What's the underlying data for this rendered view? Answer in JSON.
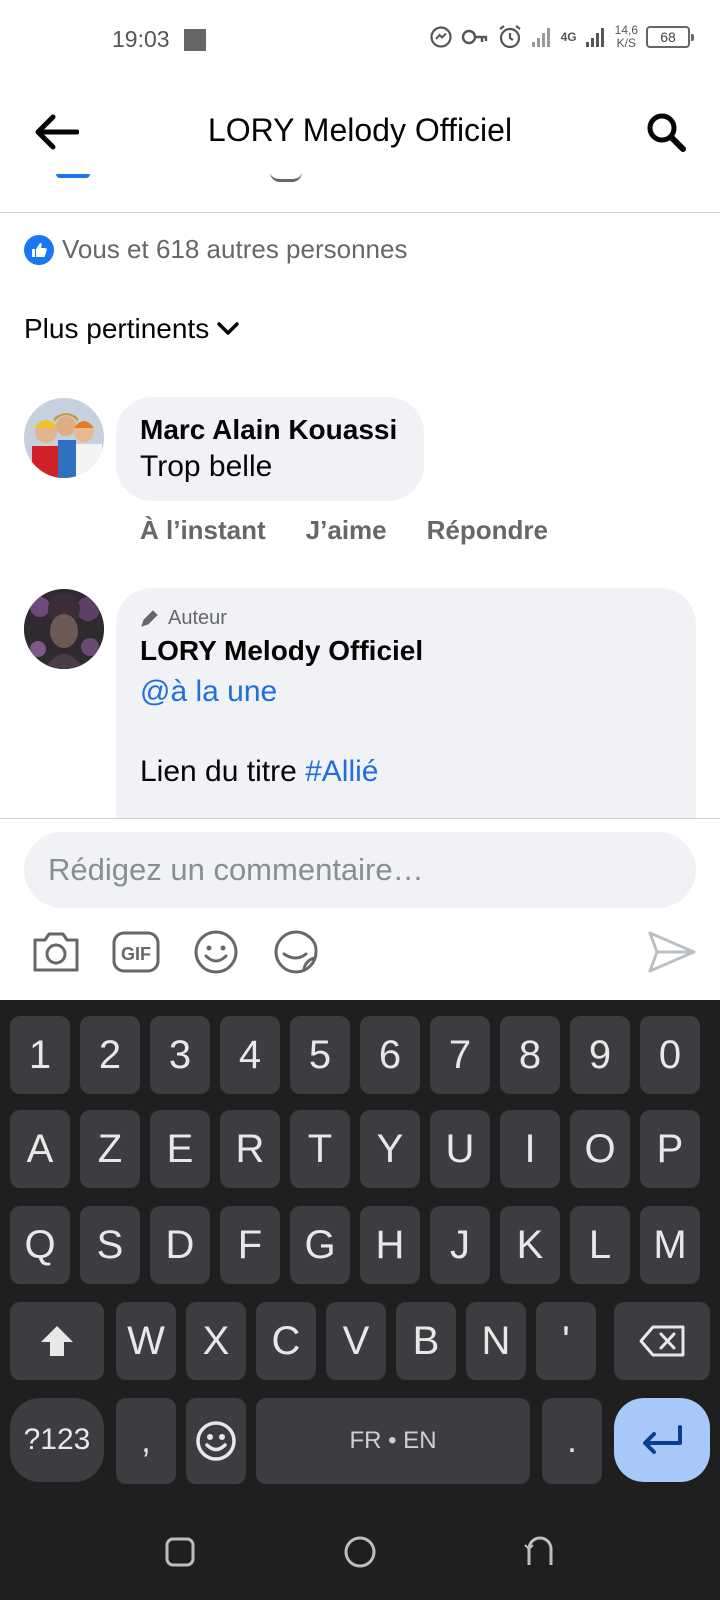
{
  "status_bar": {
    "time": "19:03",
    "network": "4G",
    "speed_value": "14,6",
    "speed_unit": "K/S",
    "battery": "68"
  },
  "header": {
    "title": "LORY Melody Officiel",
    "back_icon": "arrow-left-icon",
    "search_icon": "search-icon"
  },
  "reactions": {
    "summary": "Vous et 618 autres personnes"
  },
  "sort": {
    "label": "Plus pertinents"
  },
  "comments": [
    {
      "author": "Marc Alain Kouassi",
      "text": "Trop belle",
      "actions": {
        "time": "À l’instant",
        "like": "J’aime",
        "reply": "Répondre"
      }
    },
    {
      "badge": "Auteur",
      "author": "LORY Melody Officiel",
      "mention": "@à la une",
      "body_text": "Lien du titre ",
      "hashtag": "#Allié"
    }
  ],
  "composer": {
    "placeholder": "Rédigez un commentaire…",
    "value": ""
  },
  "keyboard": {
    "row1": [
      "1",
      "2",
      "3",
      "4",
      "5",
      "6",
      "7",
      "8",
      "9",
      "0"
    ],
    "row2": [
      "A",
      "Z",
      "E",
      "R",
      "T",
      "Y",
      "U",
      "I",
      "O",
      "P"
    ],
    "row3": [
      "Q",
      "S",
      "D",
      "F",
      "G",
      "H",
      "J",
      "K",
      "L",
      "M"
    ],
    "row4": [
      "W",
      "X",
      "C",
      "V",
      "B",
      "N",
      "'"
    ],
    "sym_key": "?123",
    "comma_key": ",",
    "space_label": "FR • EN",
    "period_key": "."
  },
  "colors": {
    "accent": "#1877f2",
    "link": "#216fdb",
    "bubble": "#f0f2f5",
    "keyboard_bg": "#1f1f1f",
    "key_bg": "#3c3d40",
    "enter_key": "#a9c8fa"
  }
}
